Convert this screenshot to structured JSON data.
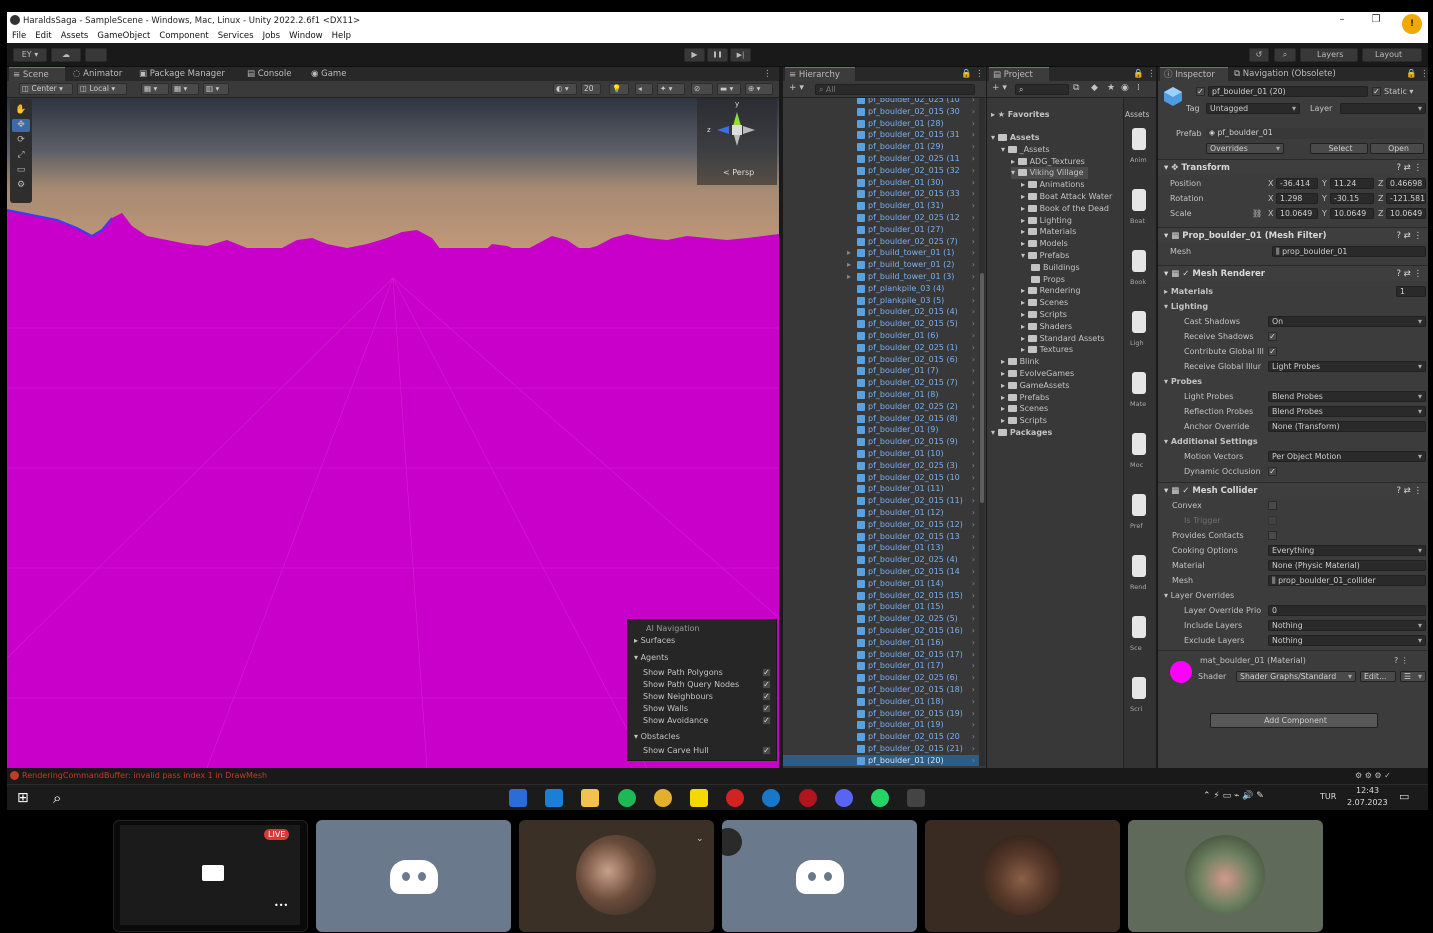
{
  "window": {
    "title": "HaraldsSaga - SampleScene - Windows, Mac, Linux - Unity 2022.2.6f1 <DX11>",
    "minimize": "–",
    "maximize": "❐",
    "close": "✕"
  },
  "menu": [
    "File",
    "Edit",
    "Assets",
    "GameObject",
    "Component",
    "Services",
    "Jobs",
    "Window",
    "Help"
  ],
  "toolbar": {
    "account": "EY ▾",
    "cloud": "☁",
    "play": "▶",
    "pause": "❚❚",
    "step": "▶|",
    "history": "↺",
    "search": "⌕",
    "layers": "Layers",
    "layout": "Layout"
  },
  "scene": {
    "tabs": [
      "Scene",
      "Animator",
      "Package Manager",
      "Console",
      "Game"
    ],
    "pivot": "Center",
    "space": "Local",
    "grid_size": "20",
    "persp": "Persp",
    "tools": [
      "✋",
      "✥",
      "⟳",
      "⤢",
      "▭",
      "⚙"
    ],
    "gizmo_y": "y",
    "gizmo_z": "z"
  },
  "nav_overlay": {
    "title": "AI Navigation",
    "rows": [
      {
        "label": "Surfaces",
        "kind": "section"
      },
      {
        "label": "Agents",
        "kind": "section"
      },
      {
        "label": "Show Path Polygons",
        "checked": true
      },
      {
        "label": "Show Path Query Nodes",
        "checked": true
      },
      {
        "label": "Show Neighbours",
        "checked": true
      },
      {
        "label": "Show Walls",
        "checked": true
      },
      {
        "label": "Show Avoidance",
        "checked": true
      },
      {
        "label": "Obstacles",
        "kind": "section"
      },
      {
        "label": "Show Carve Hull",
        "checked": true
      }
    ]
  },
  "hierarchy": {
    "tab": "Hierarchy",
    "search_placeholder": "All",
    "items": [
      "pf_boulder_02_025 (10",
      "pf_boulder_02_015 (30",
      "pf_boulder_01 (28)",
      "pf_boulder_02_015 (31",
      "pf_boulder_01 (29)",
      "pf_boulder_02_025 (11",
      "pf_boulder_02_015 (32",
      "pf_boulder_01 (30)",
      "pf_boulder_02_015 (33",
      "pf_boulder_01 (31)",
      "pf_boulder_02_025 (12",
      "pf_boulder_01 (27)",
      "pf_boulder_02_025 (7)",
      "pf_build_tower_01 (1)",
      "pf_build_tower_01 (2)",
      "pf_build_tower_01 (3)",
      "pf_plankpile_03 (4)",
      "pf_plankpile_03 (5)",
      "pf_boulder_02_015 (4)",
      "pf_boulder_02_015 (5)",
      "pf_boulder_01 (6)",
      "pf_boulder_02_025 (1)",
      "pf_boulder_02_015 (6)",
      "pf_boulder_01 (7)",
      "pf_boulder_02_015 (7)",
      "pf_boulder_01 (8)",
      "pf_boulder_02_025 (2)",
      "pf_boulder_02_015 (8)",
      "pf_boulder_01 (9)",
      "pf_boulder_02_015 (9)",
      "pf_boulder_01 (10)",
      "pf_boulder_02_025 (3)",
      "pf_boulder_02_015 (10",
      "pf_boulder_01 (11)",
      "pf_boulder_02_015 (11)",
      "pf_boulder_01 (12)",
      "pf_boulder_02_015 (12)",
      "pf_boulder_02_015 (13",
      "pf_boulder_01 (13)",
      "pf_boulder_02_025 (4)",
      "pf_boulder_02_015 (14",
      "pf_boulder_01 (14)",
      "pf_boulder_02_015 (15)",
      "pf_boulder_01 (15)",
      "pf_boulder_02_025 (5)",
      "pf_boulder_02_015 (16)",
      "pf_boulder_01 (16)",
      "pf_boulder_02_015 (17)",
      "pf_boulder_01 (17)",
      "pf_boulder_02_025 (6)",
      "pf_boulder_02_015 (18)",
      "pf_boulder_01 (18)",
      "pf_boulder_02_015 (19)",
      "pf_boulder_01 (19)",
      "pf_boulder_02_015 (20",
      "pf_boulder_02_015 (21)",
      "pf_boulder_01 (20)"
    ],
    "selected_index": 56
  },
  "project": {
    "tab": "Project",
    "favorites": "Favorites",
    "assets_col": "Assets",
    "tree": [
      {
        "label": "Assets",
        "depth": 0,
        "bold": true
      },
      {
        "label": "_Assets",
        "depth": 1
      },
      {
        "label": "ADG_Textures",
        "depth": 2
      },
      {
        "label": "Viking Village",
        "depth": 2,
        "selected": true
      },
      {
        "label": "Animations",
        "depth": 3
      },
      {
        "label": "Boat Attack Water",
        "depth": 3
      },
      {
        "label": "Book of the Dead",
        "depth": 3
      },
      {
        "label": "Lighting",
        "depth": 3
      },
      {
        "label": "Materials",
        "depth": 3
      },
      {
        "label": "Models",
        "depth": 3
      },
      {
        "label": "Prefabs",
        "depth": 3
      },
      {
        "label": "Buildings",
        "depth": 4
      },
      {
        "label": "Props",
        "depth": 4
      },
      {
        "label": "Rendering",
        "depth": 3
      },
      {
        "label": "Scenes",
        "depth": 3
      },
      {
        "label": "Scripts",
        "depth": 3
      },
      {
        "label": "Shaders",
        "depth": 3
      },
      {
        "label": "Standard Assets",
        "depth": 3
      },
      {
        "label": "Textures",
        "depth": 3
      },
      {
        "label": "Blink",
        "depth": 1
      },
      {
        "label": "EvolveGames",
        "depth": 1
      },
      {
        "label": "GameAssets",
        "depth": 1
      },
      {
        "label": "Prefabs",
        "depth": 1
      },
      {
        "label": "Scenes",
        "depth": 1
      },
      {
        "label": "Scripts",
        "depth": 1
      },
      {
        "label": "Packages",
        "depth": 0,
        "bold": true
      }
    ],
    "grid": [
      "Anim",
      "Boat",
      "Book",
      "Ligh",
      "Mate",
      "Moc",
      "Pref",
      "Rend",
      "Sce",
      "Scri"
    ]
  },
  "inspector": {
    "tabs": [
      "Inspector",
      "Navigation (Obsolete)"
    ],
    "name": "pf_boulder_01 (20)",
    "static": "Static",
    "tag_label": "Tag",
    "tag": "Untagged",
    "layer_label": "Layer",
    "layer": "",
    "prefab_label": "Prefab",
    "prefab": "pf_boulder_01",
    "overrides": "Overrides",
    "select": "Select",
    "open": "Open",
    "transform": {
      "title": "Transform",
      "position": {
        "label": "Position",
        "x": "-36.414",
        "y": "11.24",
        "z": "0.46698"
      },
      "rotation": {
        "label": "Rotation",
        "x": "1.298",
        "y": "-30.15",
        "z": "-121.581"
      },
      "scale": {
        "label": "Scale",
        "x": "10.0649",
        "y": "10.0649",
        "z": "10.0649"
      }
    },
    "mesh_filter": {
      "title": "Prop_boulder_01 (Mesh Filter)",
      "mesh_label": "Mesh",
      "mesh": "prop_boulder_01"
    },
    "mesh_renderer": {
      "title": "Mesh Renderer",
      "materials_label": "Materials",
      "materials_count": "1",
      "lighting": "Lighting",
      "cast_shadows_label": "Cast Shadows",
      "cast_shadows": "On",
      "receive_shadows_label": "Receive Shadows",
      "contribute_gi_label": "Contribute Global Ill",
      "receive_gi_label": "Receive Global Illur",
      "receive_gi": "Light Probes",
      "probes": "Probes",
      "light_probes_label": "Light Probes",
      "light_probes": "Blend Probes",
      "reflection_probes_label": "Reflection Probes",
      "reflection_probes": "Blend Probes",
      "anchor_override_label": "Anchor Override",
      "anchor_override": "None (Transform)",
      "additional": "Additional Settings",
      "motion_vectors_label": "Motion Vectors",
      "motion_vectors": "Per Object Motion",
      "dynamic_occlusion_label": "Dynamic Occlusion"
    },
    "mesh_collider": {
      "title": "Mesh Collider",
      "convex_label": "Convex",
      "is_trigger_label": "Is Trigger",
      "provides_contacts_label": "Provides Contacts",
      "cooking_label": "Cooking Options",
      "cooking": "Everything",
      "material_label": "Material",
      "material": "None (Physic Material)",
      "mesh_label": "Mesh",
      "mesh": "prop_boulder_01_collider",
      "layer_overrides": "Layer Overrides",
      "priority_label": "Layer Override Prio",
      "priority": "0",
      "include_label": "Include Layers",
      "include": "Nothing",
      "exclude_label": "Exclude Layers",
      "exclude": "Nothing"
    },
    "material": {
      "title": "mat_boulder_01 (Material)",
      "shader_label": "Shader",
      "shader": "Shader Graphs/Standard",
      "edit": "Edit...",
      "color": "#ff00ff"
    },
    "add_component": "Add Component"
  },
  "status": {
    "message": "RenderingCommandBuffer: invalid pass index 1 in DrawMesh"
  },
  "taskbar": {
    "lang": "TUR",
    "time": "12:43",
    "date": "2.07.2023"
  },
  "call": {
    "live": "LIVE",
    "more": "•••"
  },
  "colors": {
    "accent": "#4d7ab8",
    "magenta": "#c900c9",
    "hier_blue": "#7ab1f0",
    "error": "#c23a2a",
    "discord": "#5865f2"
  }
}
